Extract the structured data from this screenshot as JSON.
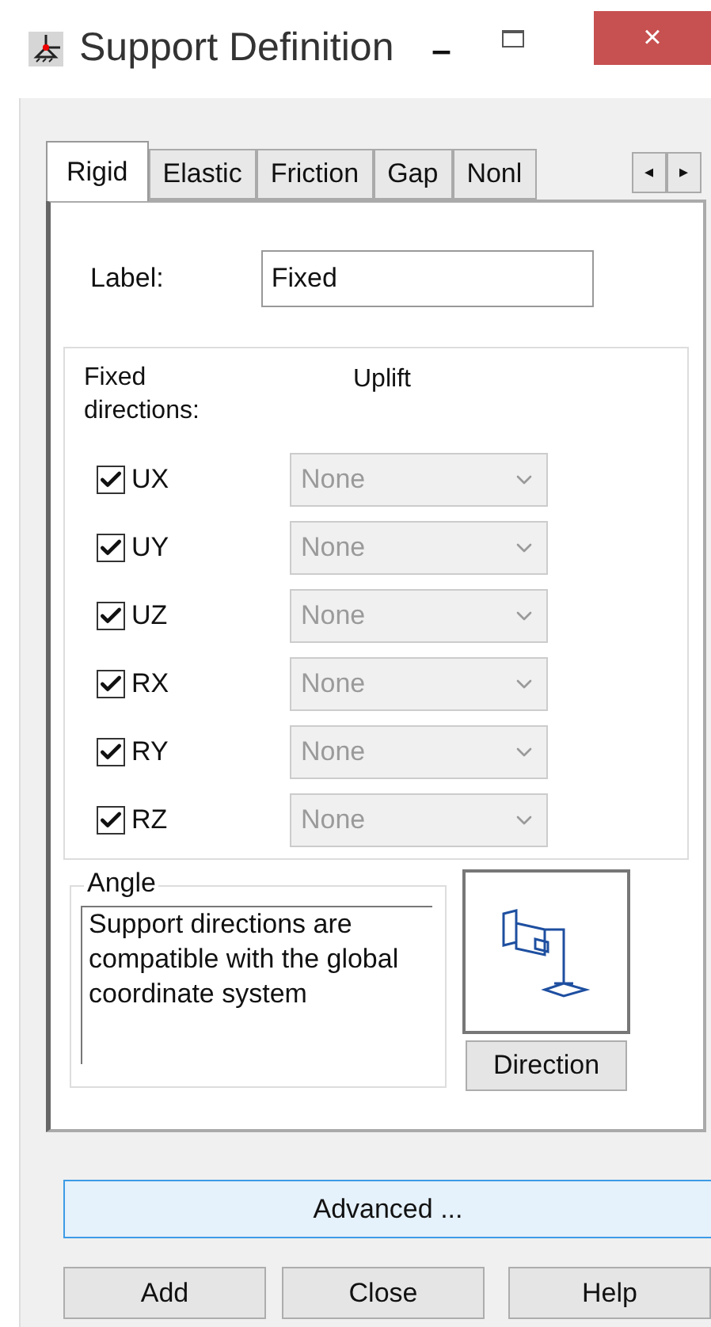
{
  "window": {
    "title": "Support Definition",
    "minimize": "–",
    "close": "×"
  },
  "tabs": [
    {
      "label": "Rigid",
      "selected": true
    },
    {
      "label": "Elastic",
      "selected": false
    },
    {
      "label": "Friction",
      "selected": false
    },
    {
      "label": "Gap",
      "selected": false
    },
    {
      "label": "Nonl",
      "selected": false
    }
  ],
  "tab_scroll": [
    "◂",
    "▸"
  ],
  "label_field": {
    "label": "Label:",
    "value": "Fixed"
  },
  "directions": {
    "heading": "Fixed directions:",
    "uplift_heading": "Uplift",
    "rows": [
      {
        "name": "UX",
        "checked": true,
        "uplift": "None",
        "disabled": true
      },
      {
        "name": "UY",
        "checked": true,
        "uplift": "None",
        "disabled": true
      },
      {
        "name": "UZ",
        "checked": true,
        "uplift": "None",
        "disabled": true
      },
      {
        "name": "RX",
        "checked": true,
        "uplift": "None",
        "disabled": true
      },
      {
        "name": "RY",
        "checked": true,
        "uplift": "None",
        "disabled": true
      },
      {
        "name": "RZ",
        "checked": true,
        "uplift": "None",
        "disabled": true
      }
    ]
  },
  "angle": {
    "title": "Angle",
    "text": "Support directions are compatible with the global coordinate system"
  },
  "direction_button": "Direction",
  "advanced_button": "Advanced ...",
  "buttons": [
    "Add",
    "Close",
    "Help"
  ]
}
